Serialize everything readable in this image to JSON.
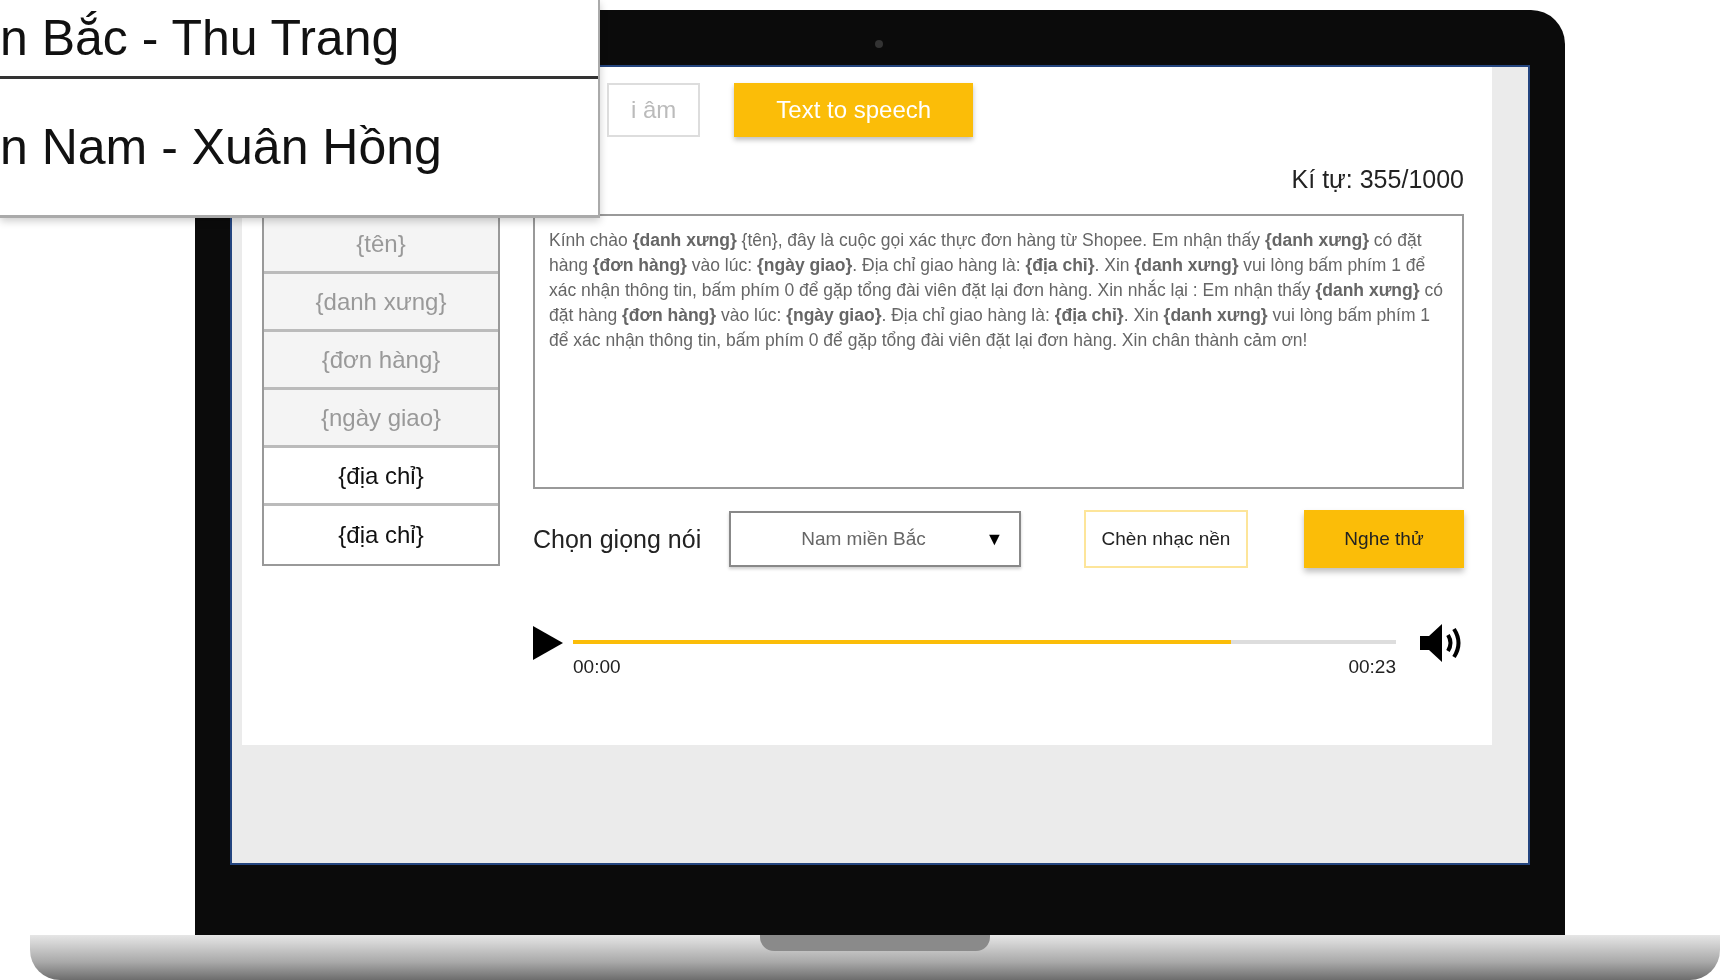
{
  "voice_callout": {
    "options": [
      "n Bắc - Thu Trang",
      "n Nam - Xuân Hồng"
    ]
  },
  "tabs": [
    {
      "label": "i âm",
      "selected": false
    },
    {
      "label": "Text to speech",
      "selected": true
    }
  ],
  "char_count": "Kí tự: 355/1000",
  "variables": [
    "{tên}",
    "{danh xưng}",
    "{đơn hàng}",
    "{ngày giao}",
    "{địa chỉ}",
    "{địa chỉ}"
  ],
  "script_text": "Kính chào **{danh xưng}** {tên}, đây là cuộc gọi xác thực đơn hàng từ Shopee. Em nhận thấy **{danh xưng}** có đặt hàng **{đơn hàng}** vào lúc: **{ngày giao}**. Địa chỉ giao hàng là: **{địa chỉ}**. Xin **{danh xưng}** vui lòng bấm phím 1 để xác nhận thông tin, bấm phím 0 để gặp tổng đài viên đặt lại đơn hàng. Xin nhắc lại : Em nhận thấy **{danh xưng}** có đặt hàng **{đơn hàng}** vào lúc: **{ngày giao}**. Địa chỉ giao hàng là: **{địa chỉ}**. Xin **{danh xưng}** vui lòng bấm phím 1 để xác nhận thông tin, bấm phím 0 để gặp tổng đài viên đặt lại đơn hàng. Xin chân thành cảm ơn!",
  "voice_label": "Chọn giọng nói",
  "voice_select": {
    "value": "Nam miền Bắc",
    "arrow": "▼"
  },
  "buttons": [
    {
      "label": "Chèn nhạc nền",
      "kind": "outline"
    },
    {
      "label": "Nghe thử",
      "kind": "primary"
    }
  ],
  "player": {
    "level": 0.8,
    "current_time": "00:00",
    "duration": "00:23"
  }
}
